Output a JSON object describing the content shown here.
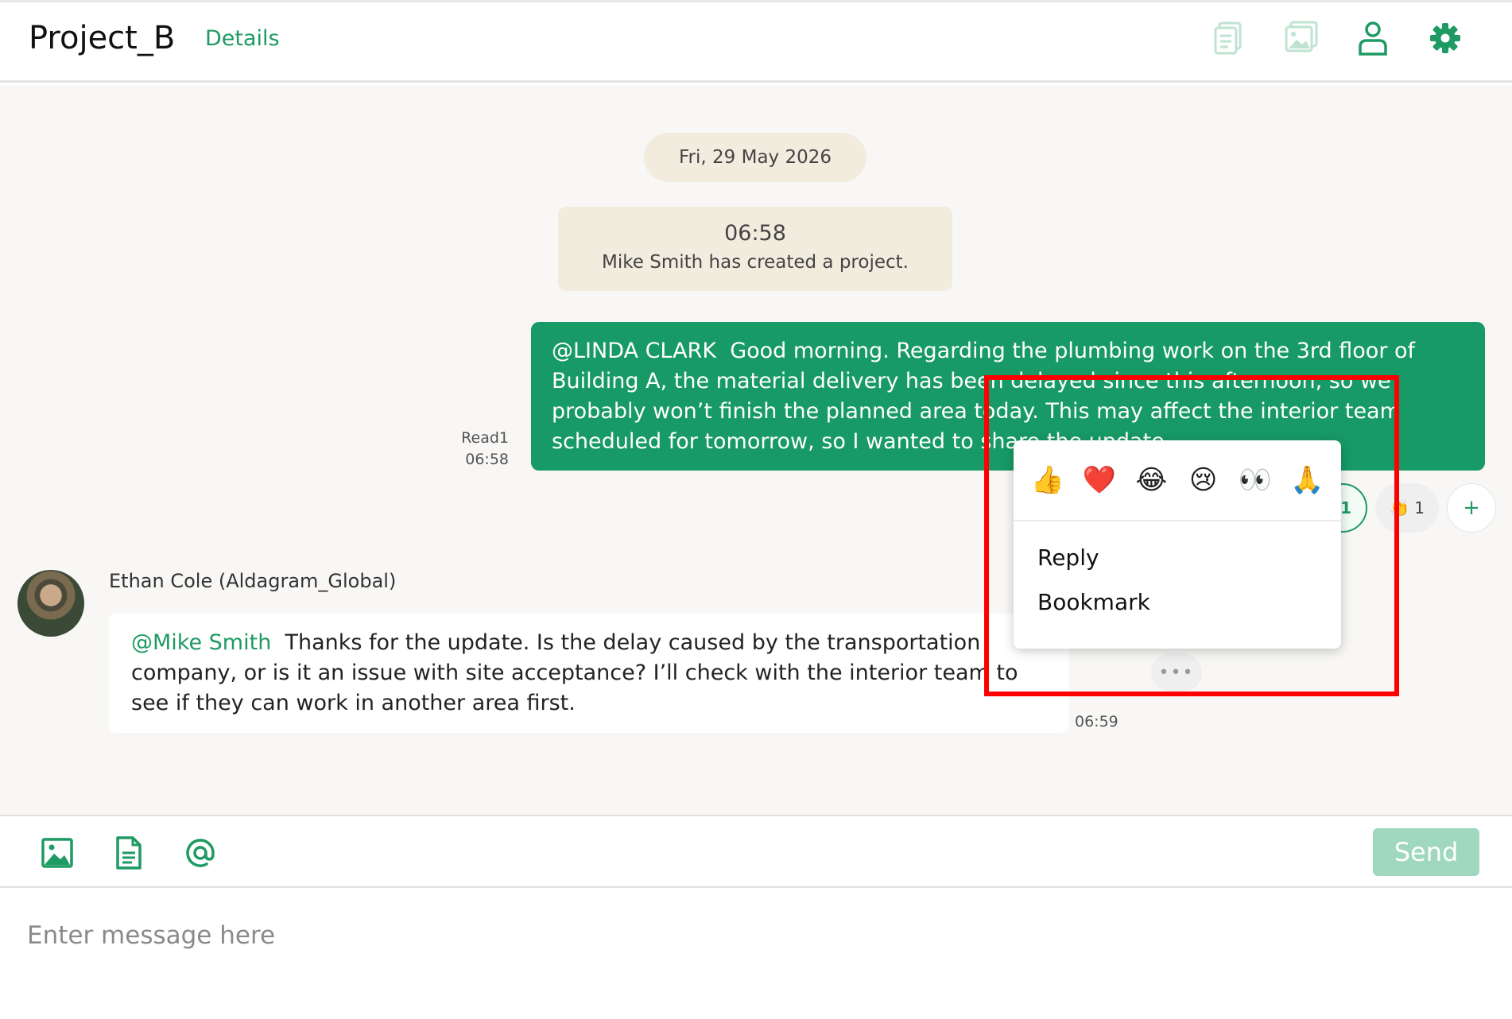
{
  "header": {
    "title": "Project_B",
    "details_label": "Details",
    "icons": [
      "files-icon",
      "images-icon",
      "member-icon",
      "settings-icon"
    ]
  },
  "chat": {
    "date_label": "Fri, 29 May 2026",
    "system_message": {
      "time": "06:58",
      "text": "Mike Smith has created a project."
    },
    "outgoing_message": {
      "mention": "@LINDA CLARK",
      "text": "Good morning. Regarding the plumbing work on the 3rd floor of Building A, the material delivery has been delayed since this afternoon, so we probably won’t finish the planned area today. This may affect the interior team scheduled for tomorrow, so I wanted to share the update.",
      "read_label": "Read",
      "read_count": "1",
      "time": "06:58",
      "reactions": [
        {
          "emoji": "",
          "count": "1"
        },
        {
          "emoji": "👏",
          "count": "1"
        }
      ],
      "add_reaction_label": "+"
    },
    "incoming_message": {
      "sender": "Ethan Cole (Aldagram_Global)",
      "mention": "@Mike Smith",
      "text": "Thanks for the update. Is the delay caused by the transportation company, or is it an issue with site acceptance? I’ll check with the interior team to see if they can work in another area first.",
      "time": "06:59",
      "more_label": "•••"
    }
  },
  "context_menu": {
    "emojis": [
      "👍",
      "❤️",
      "😂",
      "😢",
      "👀",
      "🙏"
    ],
    "items": [
      "Reply",
      "Bookmark"
    ]
  },
  "composer": {
    "send_label": "Send",
    "placeholder": "Enter message here",
    "value": ""
  },
  "colors": {
    "brand_green": "#179a65",
    "highlight_red": "#ff0000",
    "system_bg": "#f2ecdf"
  }
}
